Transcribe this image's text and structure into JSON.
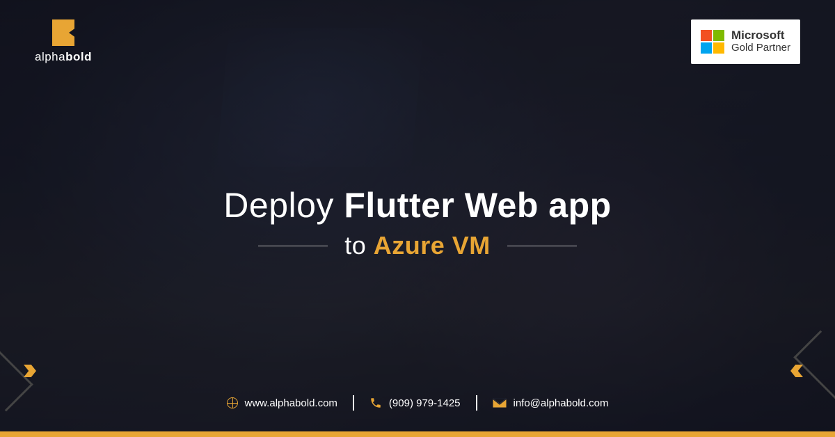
{
  "brand": {
    "name_light": "alpha",
    "name_bold": "bold"
  },
  "partner_badge": {
    "line1": "Microsoft",
    "line2": "Gold Partner"
  },
  "headline": {
    "line1_light": "Deploy ",
    "line1_bold": "Flutter Web app",
    "line2_white": "to ",
    "line2_gold": "Azure VM"
  },
  "footer": {
    "website": "www.alphabold.com",
    "phone": "(909) 979-1425",
    "email": "info@alphabold.com"
  },
  "colors": {
    "accent": "#e8a534"
  }
}
